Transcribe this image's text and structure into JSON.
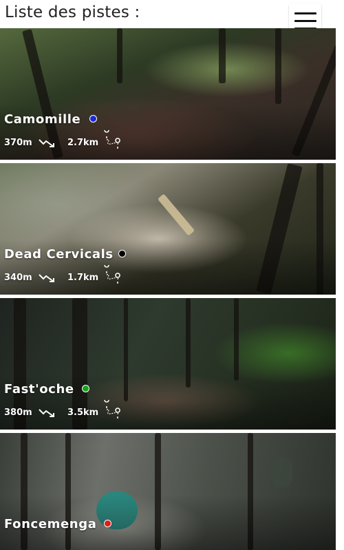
{
  "header": {
    "title": "Liste des pistes :",
    "menu_icon": "hamburger-menu-icon"
  },
  "tracks": [
    {
      "name": "Camomille",
      "elevation": "370m",
      "distance": "2.7km",
      "difficulty_color": "#1a2bd6"
    },
    {
      "name": "Dead Cervicals",
      "elevation": "340m",
      "distance": "1.7km",
      "difficulty_color": "#000000"
    },
    {
      "name": "Fast'oche",
      "elevation": "380m",
      "distance": "3.5km",
      "difficulty_color": "#16a318"
    },
    {
      "name": "Foncemenga",
      "elevation": "",
      "distance": "",
      "difficulty_color": "#e21b1b"
    }
  ],
  "icons": {
    "descent": "descent-trend-icon",
    "route": "route-pin-icon"
  }
}
